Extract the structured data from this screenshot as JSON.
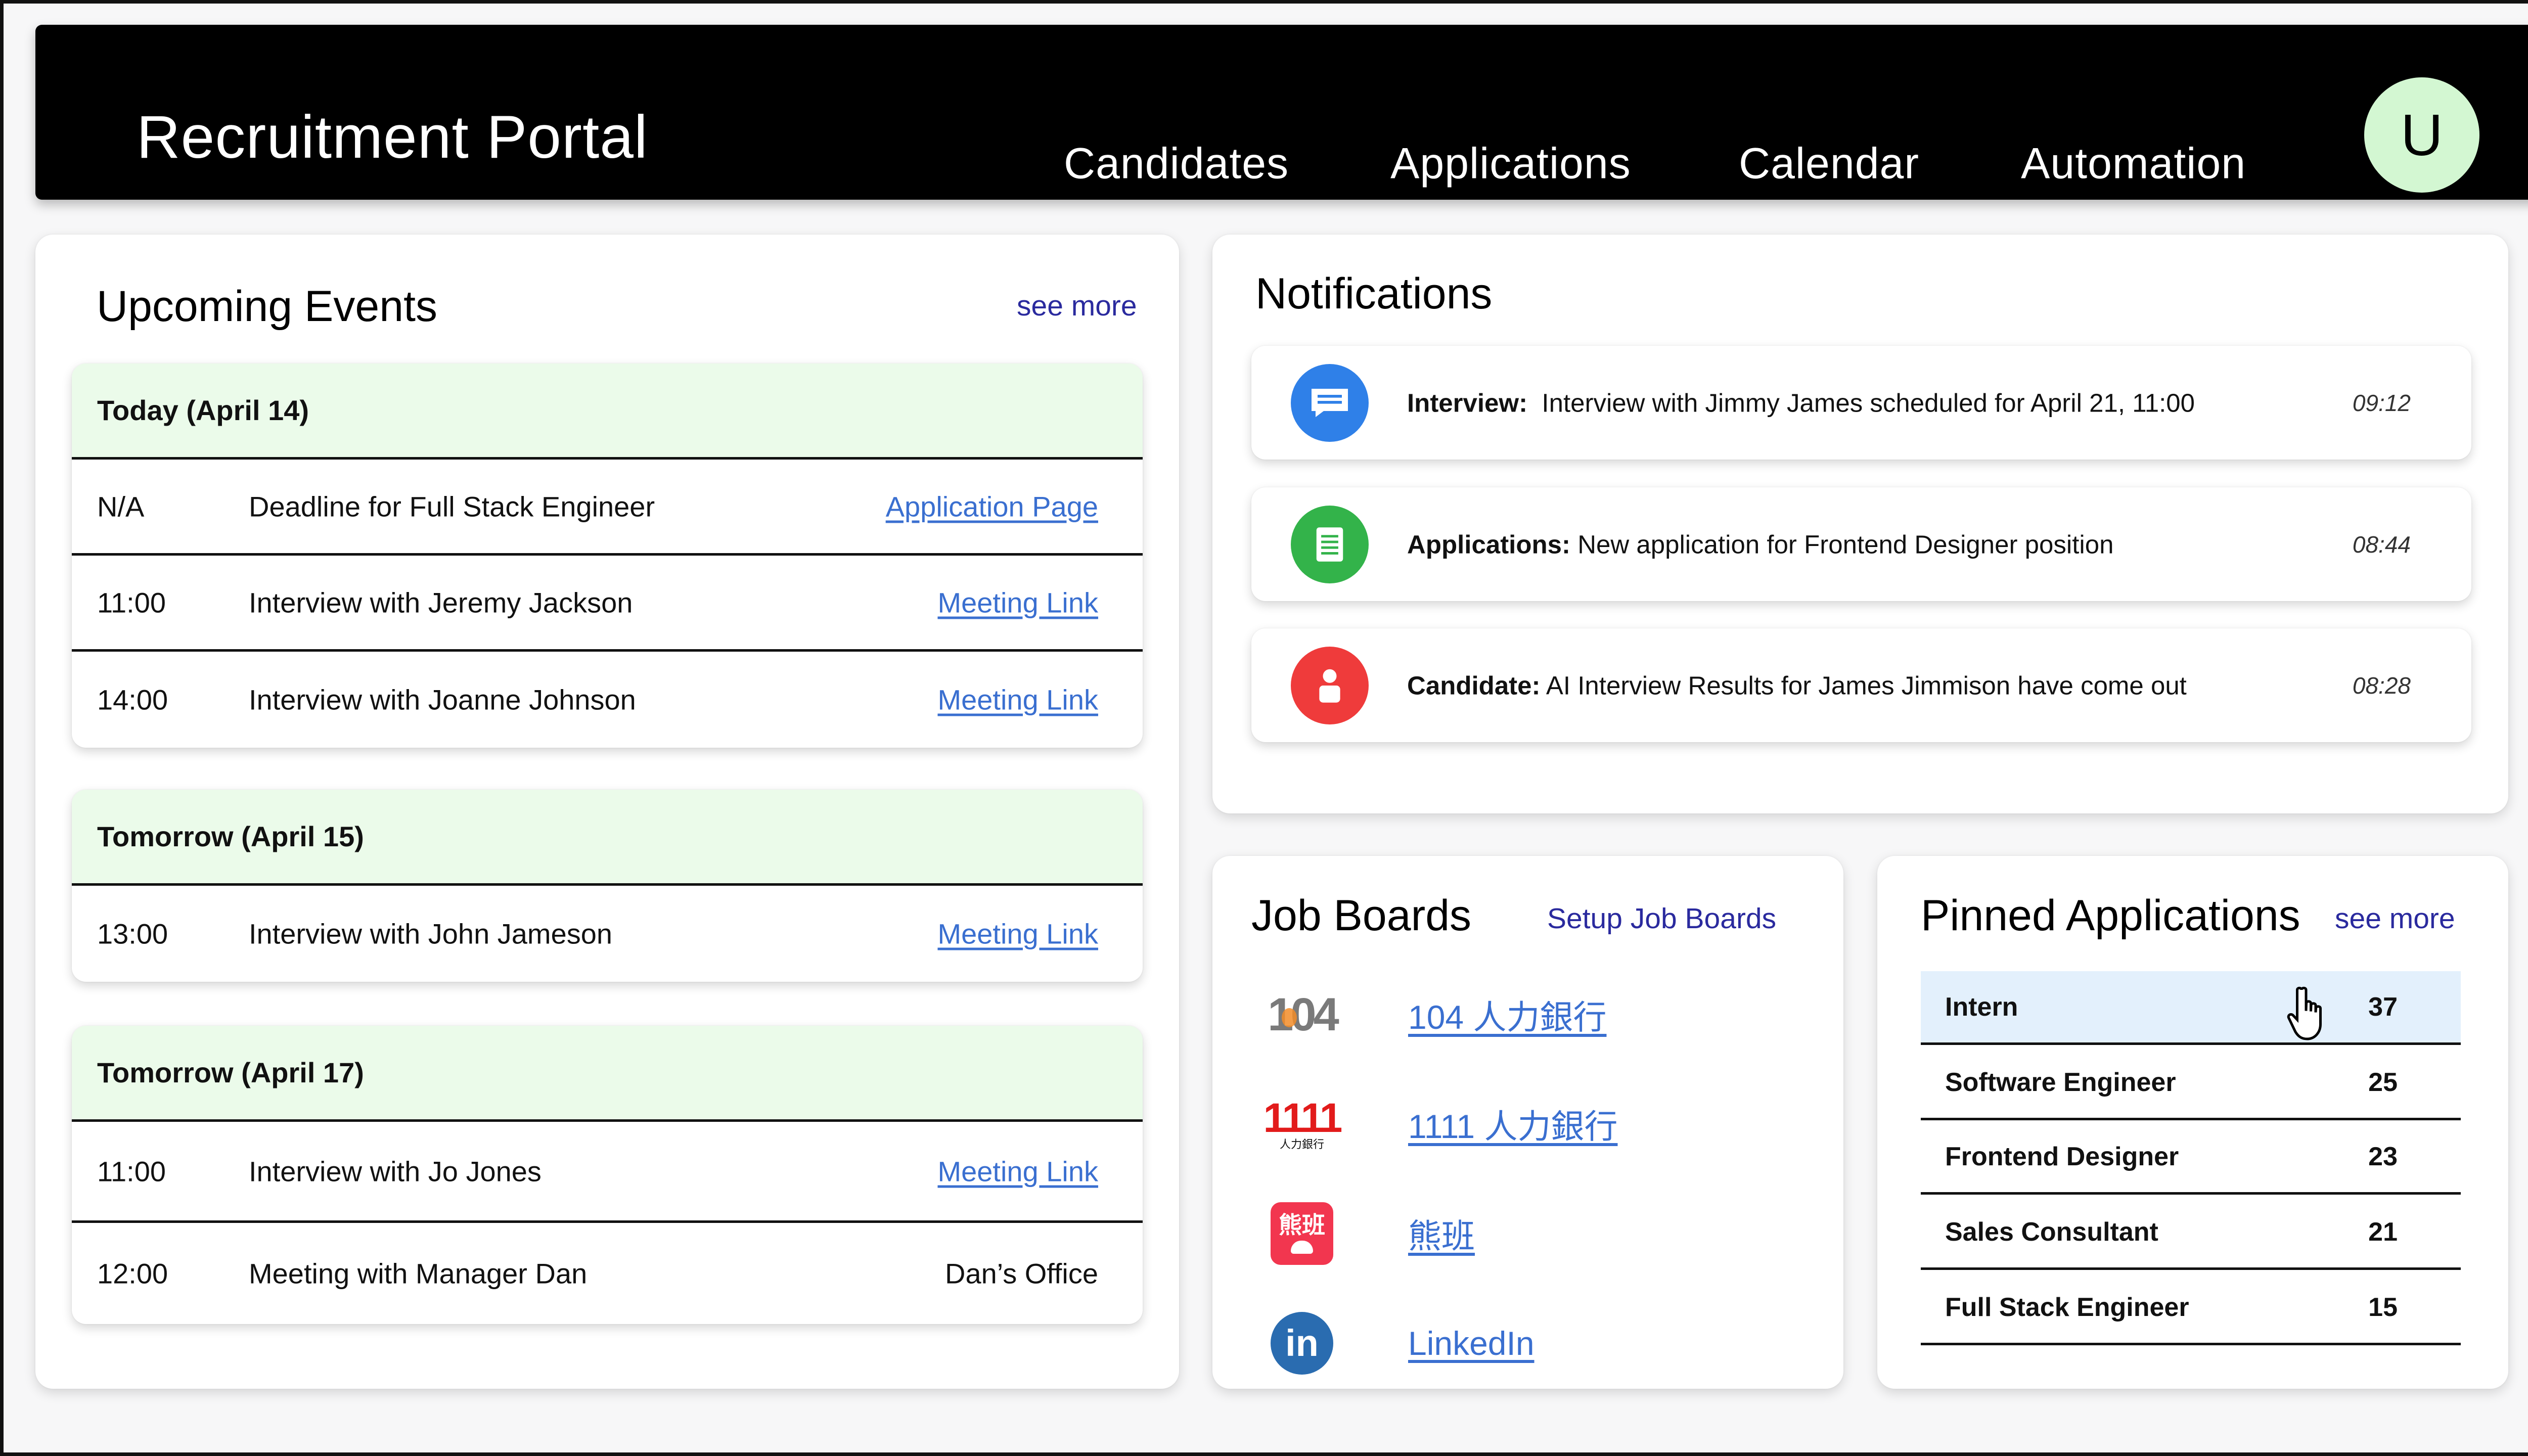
{
  "header": {
    "title": "Recruitment Portal",
    "nav": [
      "Candidates",
      "Applications",
      "Calendar",
      "Automation"
    ],
    "avatar_letter": "U"
  },
  "upcoming": {
    "title": "Upcoming Events",
    "see_more": "see more",
    "groups": [
      {
        "heading": "Today (April 14)",
        "events": [
          {
            "time": "N/A",
            "desc": "Deadline for Full Stack Engineer",
            "action": "Application Page"
          },
          {
            "time": "11:00",
            "desc": "Interview with Jeremy Jackson",
            "action": "Meeting Link"
          },
          {
            "time": "14:00",
            "desc": "Interview with Joanne Johnson",
            "action": "Meeting Link"
          }
        ]
      },
      {
        "heading": "Tomorrow (April 15)",
        "events": [
          {
            "time": "13:00",
            "desc": "Interview with John Jameson",
            "action": "Meeting Link"
          }
        ]
      },
      {
        "heading": "Tomorrow (April 17)",
        "events": [
          {
            "time": "11:00",
            "desc": "Interview with Jo Jones",
            "action": "Meeting Link"
          },
          {
            "time": "12:00",
            "desc": "Meeting with Manager Dan",
            "location": "Dan’s Office"
          }
        ]
      }
    ]
  },
  "notifications": {
    "title": "Notifications",
    "items": [
      {
        "label": "Interview:",
        "text": "Interview with Jimmy James scheduled for April 21, 11:00",
        "time": "09:12",
        "icon": "chat-icon",
        "color": "#2f80e8"
      },
      {
        "label": "Applications:",
        "text": "New application for Frontend Designer position",
        "time": "08:44",
        "icon": "document-icon",
        "color": "#33b34a"
      },
      {
        "label": "Candidate:",
        "text": "AI Interview Results for James Jimmison have come out",
        "time": "08:28",
        "icon": "person-icon",
        "color": "#ef3b3b"
      }
    ]
  },
  "job_boards": {
    "title": "Job Boards",
    "setup": "Setup Job Boards",
    "items": [
      {
        "name": "104 人力銀行",
        "logo_text": "104"
      },
      {
        "name": "1111 人力銀行",
        "logo_text": "1111",
        "logo_sub": "人力銀行"
      },
      {
        "name": "熊班",
        "logo_text": "熊班"
      },
      {
        "name": "LinkedIn",
        "logo_text": "in"
      }
    ]
  },
  "pinned": {
    "title": "Pinned Applications",
    "see_more": "see more",
    "items": [
      {
        "name": "Intern",
        "count": "37"
      },
      {
        "name": "Software Engineer",
        "count": "25"
      },
      {
        "name": "Frontend Designer",
        "count": "23"
      },
      {
        "name": "Sales Consultant",
        "count": "21"
      },
      {
        "name": "Full Stack Engineer",
        "count": "15"
      }
    ]
  }
}
